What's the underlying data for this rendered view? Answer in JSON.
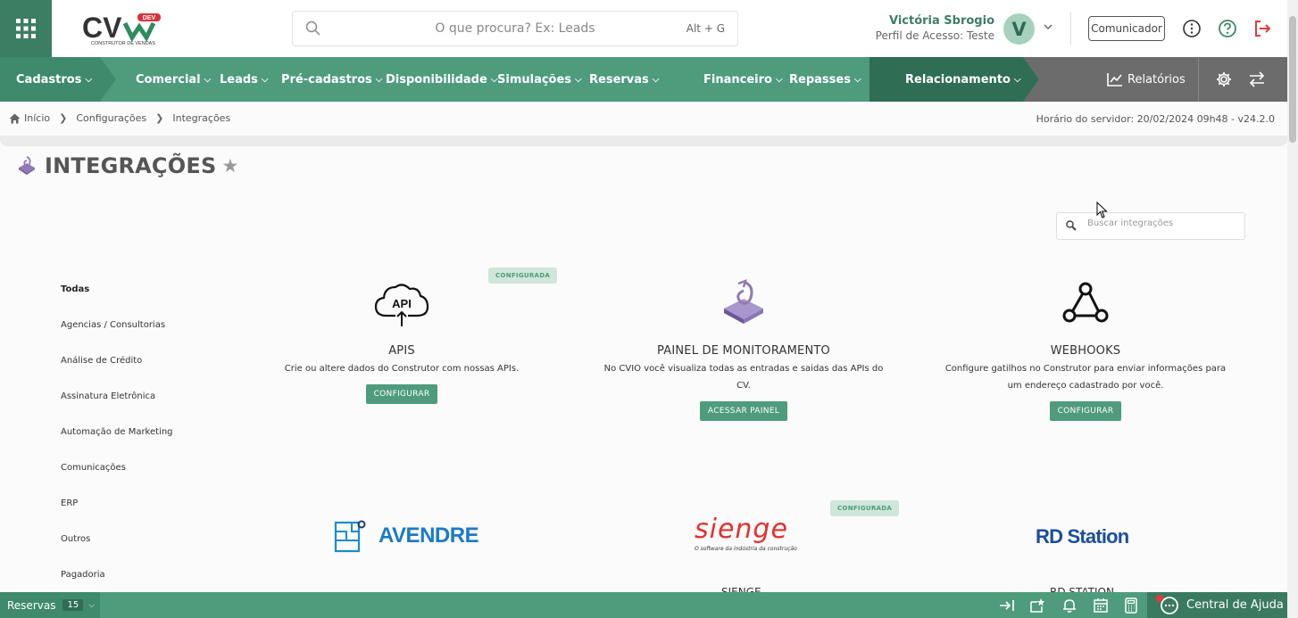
{
  "header": {
    "logo_text": "CV",
    "logo_badge": "DEV",
    "logo_sub": "CONSTRUTOR DE VENDAS",
    "search_placeholder": "O que procura? Ex: Leads",
    "search_shortcut": "Alt + G",
    "user_name": "Victória Sbrogio",
    "user_profile": "Perfil de Acesso: Teste",
    "avatar_letter": "V",
    "comunicador_label": "Comunicador"
  },
  "nav": {
    "items": [
      "Cadastros",
      "Comercial",
      "Leads",
      "Pré-cadastros",
      "Disponibilidade",
      "Simulações",
      "Reservas",
      "Financeiro",
      "Repasses",
      "Relacionamento"
    ],
    "relatorios": "Relatórios"
  },
  "breadcrumb": [
    "Início",
    "Configurações",
    "Integrações"
  ],
  "server_time": "Horário do servidor: 20/02/2024 09h48 - v24.2.0",
  "page_title": "INTEGRAÇÕES",
  "integration_search_placeholder": "Buscar integrações",
  "categories": [
    "Todas",
    "Agencias / Consultorias",
    "Análise de Crédito",
    "Assinatura Eletrônica",
    "Automação de Marketing",
    "Comunicações",
    "ERP",
    "Outros",
    "Pagadoria"
  ],
  "cards": [
    {
      "title": "APIS",
      "desc": "Crie ou altere dados do Construtor com nossas APIs.",
      "button": "CONFIGURAR",
      "badge": "CONFIGURADA",
      "icon_text": "API"
    },
    {
      "title": "PAINEL DE MONITORAMENTO",
      "desc": "No CVIO você visualiza todas as entradas e saidas das APIs do CV.",
      "button": "ACESSAR PAINEL"
    },
    {
      "title": "WEBHOOKS",
      "desc": "Configure gatilhos no Construtor para enviar informações para um endereço cadastrado por você.",
      "button": "CONFIGURAR"
    }
  ],
  "partners": [
    {
      "name": "AVENDRE"
    },
    {
      "name": "SIENGE",
      "logo": "sienge",
      "tagline": "O software da indústria da construção",
      "badge": "CONFIGURADA",
      "title_peek": "SIENGE"
    },
    {
      "name": "RD Station",
      "title_peek": "RD STATION"
    }
  ],
  "bottom": {
    "reservas_label": "Reservas",
    "reservas_count": "15",
    "help_label": "Central de Ajuda"
  },
  "colors": {
    "primary": "#4e9c7c",
    "dark": "#2f6d55",
    "danger": "#e23b3b"
  }
}
